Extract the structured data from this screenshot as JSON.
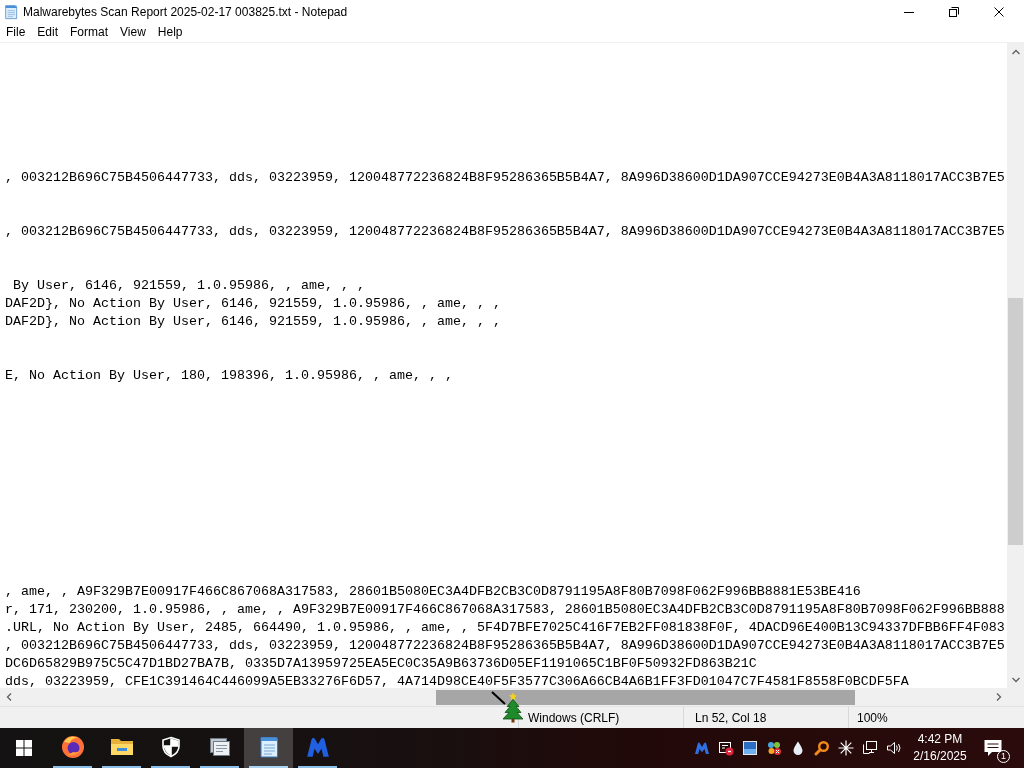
{
  "window": {
    "title": "Malwarebytes Scan Report 2025-02-17 003825.txt - Notepad"
  },
  "menu": [
    "File",
    "Edit",
    "Format",
    "View",
    "Help"
  ],
  "editor": {
    "lines": [
      {
        "kind": "blank"
      },
      {
        "kind": "blank"
      },
      {
        "kind": "blank"
      },
      {
        "kind": "blank"
      },
      {
        "kind": "blank"
      },
      {
        "kind": "blank"
      },
      {
        "kind": "blank"
      },
      {
        "kind": "text",
        "text": ", 003212B696C75B4506447733, dds, 03223959, 120048772236824B8F95286365B5B4A7, 8A996D38600D1DA907CCE94273E0B4A3A8118017ACC3B7E5"
      },
      {
        "kind": "blank"
      },
      {
        "kind": "blank"
      },
      {
        "kind": "text",
        "text": ", 003212B696C75B4506447733, dds, 03223959, 120048772236824B8F95286365B5B4A7, 8A996D38600D1DA907CCE94273E0B4A3A8118017ACC3B7E5"
      },
      {
        "kind": "blank"
      },
      {
        "kind": "blank"
      },
      {
        "kind": "text",
        "text": " By User, 6146, 921559, 1.0.95986, , ame, , ,"
      },
      {
        "kind": "text",
        "text": "DAF2D}, No Action By User, 6146, 921559, 1.0.95986, , ame, , ,"
      },
      {
        "kind": "text",
        "text": "DAF2D}, No Action By User, 6146, 921559, 1.0.95986, , ame, , ,"
      },
      {
        "kind": "blank"
      },
      {
        "kind": "blank"
      },
      {
        "kind": "text",
        "text": "E, No Action By User, 180, 198396, 1.0.95986, , ame, , ,"
      },
      {
        "kind": "blank"
      },
      {
        "kind": "blank"
      },
      {
        "kind": "blank"
      },
      {
        "kind": "blank"
      },
      {
        "kind": "blank"
      },
      {
        "kind": "blank"
      },
      {
        "kind": "blank"
      },
      {
        "kind": "blank"
      },
      {
        "kind": "blank"
      },
      {
        "kind": "blank"
      },
      {
        "kind": "blank"
      },
      {
        "kind": "text",
        "text": ", ame, , A9F329B7E00917F466C867068A317583, 28601B5080EC3A4DFB2CB3C0D8791195A8F80B7098F062F996BB8881E53BE416"
      },
      {
        "kind": "text",
        "text": "r, 171, 230200, 1.0.95986, , ame, , A9F329B7E00917F466C867068A317583, 28601B5080EC3A4DFB2CB3C0D8791195A8F80B7098F062F996BB888"
      },
      {
        "kind": "text",
        "text": ".URL, No Action By User, 2485, 664490, 1.0.95986, , ame, , 5F4D7BFE7025C416F7EB2FF081838F0F, 4DACD96E400B13C94337DFBB6FF4F083"
      },
      {
        "kind": "text",
        "text": ", 003212B696C75B4506447733, dds, 03223959, 120048772236824B8F95286365B5B4A7, 8A996D38600D1DA907CCE94273E0B4A3A8118017ACC3B7E5"
      },
      {
        "kind": "text",
        "text": "DC6D65829B975C5C47D1BD27BA7B, 0335D7A13959725EA5EC0C35A9B63736D05EF1191065C1BF0F50932FD863B21C"
      },
      {
        "kind": "text",
        "text": "dds, 03223959, CFE1C391464C446099A5EB33276F6D57, 4A714D98CE40F5F3577C306A66CB4A6B1FF3FD01047C7F4581F8558F0BCDF5FA"
      }
    ]
  },
  "status_bar": {
    "line_ending": "Windows (CRLF)",
    "position": "Ln 52, Col 18",
    "zoom": "100%"
  },
  "taskbar": {
    "apps": [
      {
        "running": true,
        "selected": false
      },
      {
        "running": true,
        "selected": false
      },
      {
        "running": true,
        "selected": false
      },
      {
        "running": true,
        "selected": false
      },
      {
        "running": true,
        "selected": true
      },
      {
        "running": true,
        "selected": false
      }
    ],
    "clock": {
      "time": "4:42 PM",
      "date": "2/16/2025"
    },
    "notification_count": "1"
  }
}
